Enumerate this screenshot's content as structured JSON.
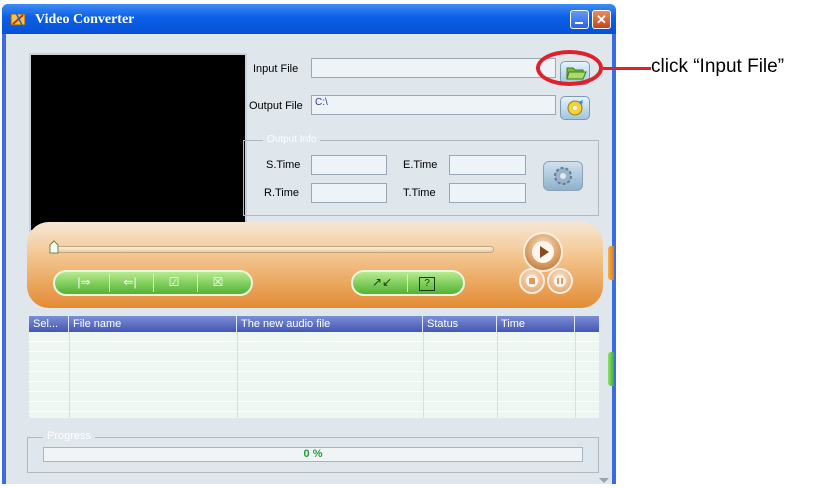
{
  "window": {
    "title": "Video Converter"
  },
  "form": {
    "input_label": "Input File",
    "input_value": "",
    "output_label": "Output File",
    "output_value": "C:\\"
  },
  "output_info": {
    "title": "Output Info",
    "s_time_label": "S.Time",
    "s_time_value": "",
    "e_time_label": "E.Time",
    "e_time_value": "",
    "r_time_label": "R.Time",
    "r_time_value": "",
    "t_time_label": "T.Time",
    "t_time_value": ""
  },
  "player": {
    "position": 0,
    "controls": [
      "|⇒",
      "⇐|",
      "☑",
      "☒"
    ],
    "tools": [
      "↗↙",
      "?"
    ]
  },
  "table": {
    "columns": [
      "Sel...",
      "File name",
      "The new audio file",
      "Status",
      "Time"
    ],
    "rows": []
  },
  "progress": {
    "title": "Progress",
    "percent": 0,
    "text": "0 %"
  },
  "annotation": {
    "text": "click “Input File”"
  },
  "colors": {
    "titlebar": "#0a5fe6",
    "annotation": "#e0202a",
    "progress": "#22a13a"
  }
}
